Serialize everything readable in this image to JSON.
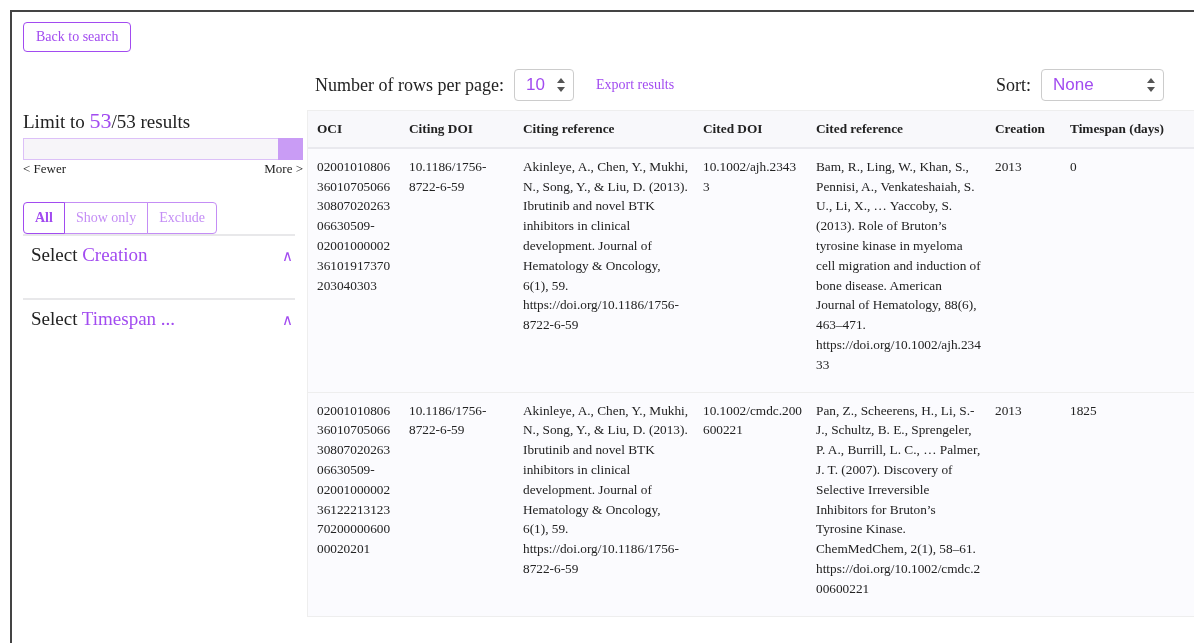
{
  "back_button": "Back to search",
  "limit": {
    "prefix": "Limit to",
    "count": "53",
    "total": "/53 results",
    "level": 1,
    "fewer": "< Fewer",
    "more": "More >"
  },
  "filter_modes": [
    {
      "label": "All",
      "selected": true
    },
    {
      "label": "Show only",
      "selected": false
    },
    {
      "label": "Exclude",
      "selected": false
    }
  ],
  "sections": [
    {
      "prefix": "Select",
      "field": "Creation",
      "chevron": "∧"
    },
    {
      "prefix": "Select",
      "field": "Timespan ...",
      "chevron": "∧"
    }
  ],
  "rows_per_page": {
    "label": "Number of rows per page:",
    "value": "10"
  },
  "export_link": "Export results",
  "sort": {
    "label": "Sort:",
    "value": "None"
  },
  "table": {
    "columns": [
      "OCI",
      "Citing DOI",
      "Citing reference",
      "Cited DOI",
      "Cited reference",
      "Creation",
      "Timespan (days)"
    ],
    "rows": [
      [
        "020010108063601070506630807020263 06630509-0200100000236101917370 203040303",
        "10.1186/1756-8722-6-59",
        "Akinleye, A., Chen, Y., Mukhi, N., Song, Y., & Liu, D. (2013). Ibrutinib and novel BTK inhibitors in clinical development. Journal of Hematology & Oncology, 6(1), 59. https://doi.org/10.1186/1756-8722-6-59",
        "10.1002/ajh.23433",
        "Bam, R., Ling, W., Khan, S., Pennisi, A., Venkateshaiah, S. U., Li, X., … Yaccoby, S. (2013). Role of Bruton’s tyrosine kinase in myeloma cell migration and induction of bone disease. American Journal of Hematology, 88(6), 463–471. https://doi.org/10.1002/ajh.23433",
        "2013",
        "0"
      ],
      [
        "020010108063601070506630807020263 06630509-0200100000236122213123 7020000060000020201",
        "10.1186/1756-8722-6-59",
        "Akinleye, A., Chen, Y., Mukhi, N., Song, Y., & Liu, D. (2013). Ibrutinib and novel BTK inhibitors in clinical development. Journal of Hematology & Oncology, 6(1), 59. https://doi.org/10.1186/1756-8722-6-59",
        "10.1002/cmdc.200600221",
        "Pan, Z., Scheerens, H., Li, S.-J., Schultz, B. E., Sprengeler, P. A., Burrill, L. C., … Palmer, J. T. (2007). Discovery of Selective Irreversible Inhibitors for Bruton’s Tyrosine Kinase. ChemMedChem, 2(1), 58–61. https://doi.org/10.1002/cmdc.200600221",
        "2013",
        "1825"
      ]
    ]
  }
}
